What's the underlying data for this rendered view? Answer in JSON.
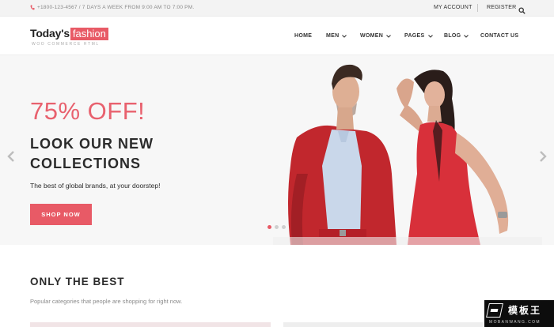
{
  "topbar": {
    "phone_text": "+1800-123-4567 / 7 DAYS A WEEK FROM 9:00 AM TO 7:00 PM.",
    "my_account": "MY ACCOUNT",
    "register": "REGISTER"
  },
  "brand": {
    "name_part1": "Today's",
    "name_part2": "fashion",
    "tagline": "WOO COMMERCE HTML"
  },
  "nav": {
    "home": "HOME",
    "men": "MEN",
    "women": "WOMEN",
    "pages": "PAGES",
    "blog": "BLOG",
    "contact": "CONTACT US"
  },
  "hero": {
    "promo": "75% OFF!",
    "headline_line1": "LOOK OUR NEW",
    "headline_line2": "COLLECTIONS",
    "subline": "The best of global brands, at your doorstep!",
    "cta": "SHOP NOW",
    "active_slide": 1,
    "slide_count": 3
  },
  "section": {
    "title": "ONLY THE BEST",
    "subtitle": "Popular categories that people are shopping for right now."
  },
  "watermark": {
    "cn": "模板王",
    "en": "MOBANWANG.COM"
  },
  "colors": {
    "accent": "#e85a66",
    "text_dark": "#2b2b2b",
    "muted": "#8a8a8a",
    "topbar_bg": "#f3f3f3",
    "hero_bg": "#f7f7f7"
  },
  "icons": [
    "phone-icon",
    "search-icon",
    "chevron-down-icon",
    "arrow-left-icon",
    "arrow-right-icon"
  ]
}
